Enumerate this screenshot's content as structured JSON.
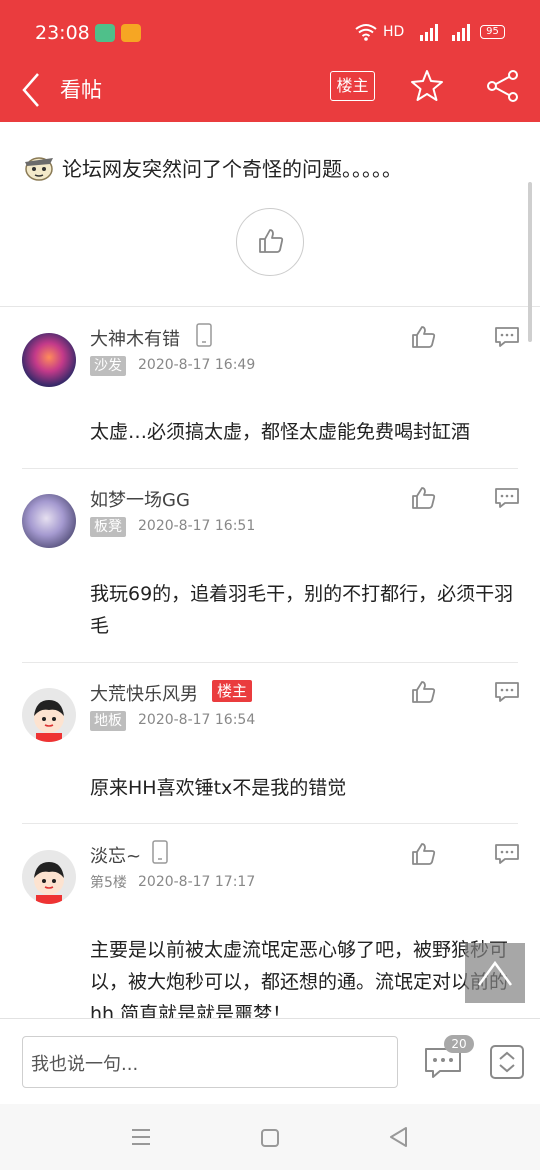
{
  "status_bar": {
    "time": "23:08",
    "network": "HD",
    "battery": "95"
  },
  "header": {
    "back_icon": "chevron-left-icon",
    "title": "看帖",
    "owner_filter": "楼主",
    "star_icon": "star-icon",
    "share_icon": "share-icon"
  },
  "post": {
    "title": "论坛网友突然问了个奇怪的问题。。。。。"
  },
  "comments": [
    {
      "username": "大神木有错",
      "floor": "沙发",
      "date": "2020-8-17 16:49",
      "text": "太虚…必须搞太虚，都怪太虚能免费喝封缸酒",
      "device": "phone-icon"
    },
    {
      "username": "如梦一场GG",
      "floor": "板凳",
      "date": "2020-8-17 16:51",
      "text": "我玩69的，追着羽毛干，别的不打都行，必须干羽毛"
    },
    {
      "username": "大荒快乐风男",
      "badge": "楼主",
      "floor": "地板",
      "date": "2020-8-17 16:54",
      "text": "原来HH喜欢锤tx不是我的错觉"
    },
    {
      "username": "淡忘~",
      "floor": "第5楼",
      "date": "2020-8-17 17:17",
      "text": "主要是以前被太虚流氓定恶心够了吧，被野狼秒可以，被大炮秒可以，都还想的通。流氓定对以前的hh 简直就是就是噩梦！",
      "device": "phone-icon"
    }
  ],
  "bottom_bar": {
    "placeholder": "我也说一句...",
    "comment_count": "20"
  },
  "colors": {
    "brand_red": "#ea3c3e",
    "text_dark": "#222222",
    "text_gray": "#888888"
  }
}
